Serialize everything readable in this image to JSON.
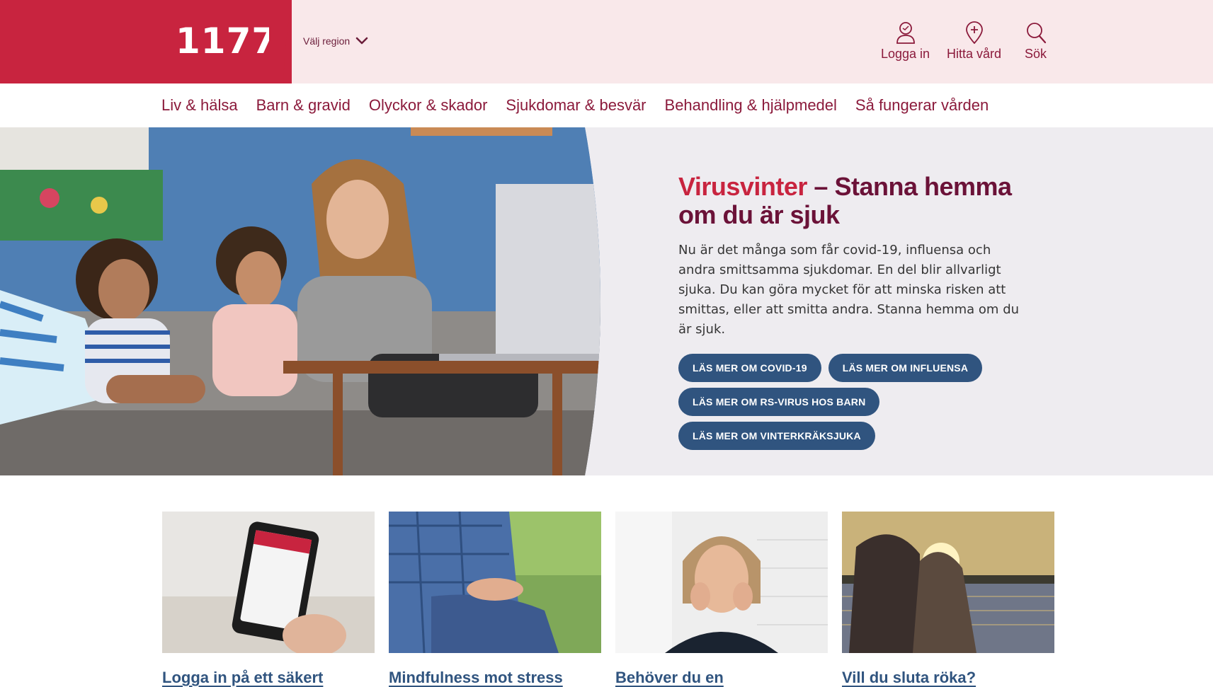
{
  "header": {
    "logo": "1177",
    "region_label": "Välj region",
    "utility": [
      {
        "label": "Logga in",
        "icon": "user-icon"
      },
      {
        "label": "Hitta vård",
        "icon": "location-plus-icon"
      },
      {
        "label": "Sök",
        "icon": "search-icon"
      }
    ]
  },
  "nav": {
    "items": [
      "Liv & hälsa",
      "Barn & gravid",
      "Olyckor & skador",
      "Sjukdomar & besvär",
      "Behandling & hjälpmedel",
      "Så fungerar vården"
    ]
  },
  "hero": {
    "title_highlight": "Virusvinter",
    "title_rest": " – Stanna hemma om du är sjuk",
    "text": "Nu är det många som får covid-19, influensa och andra smittsamma sjukdomar. En del blir allvarligt sjuka. Du kan göra mycket för att minska risken att smittas, eller att smitta andra. Stanna hemma om du är sjuk.",
    "buttons": [
      "LÄS MER OM COVID-19",
      "LÄS MER OM INFLUENSA",
      "LÄS MER OM RS-VIRUS HOS BARN",
      "LÄS MER OM VINTERKRÄKSJUKA"
    ]
  },
  "cards": [
    {
      "title": "Logga in på ett säkert"
    },
    {
      "title": "Mindfulness mot stress"
    },
    {
      "title": "Behöver du en"
    },
    {
      "title": "Vill du sluta röka?"
    }
  ],
  "colors": {
    "brand_red": "#c8243f",
    "header_bg": "#f9e8ea",
    "nav_text": "#8b1a3b",
    "button_blue": "#30547f",
    "hero_bg": "#eeecf0"
  }
}
